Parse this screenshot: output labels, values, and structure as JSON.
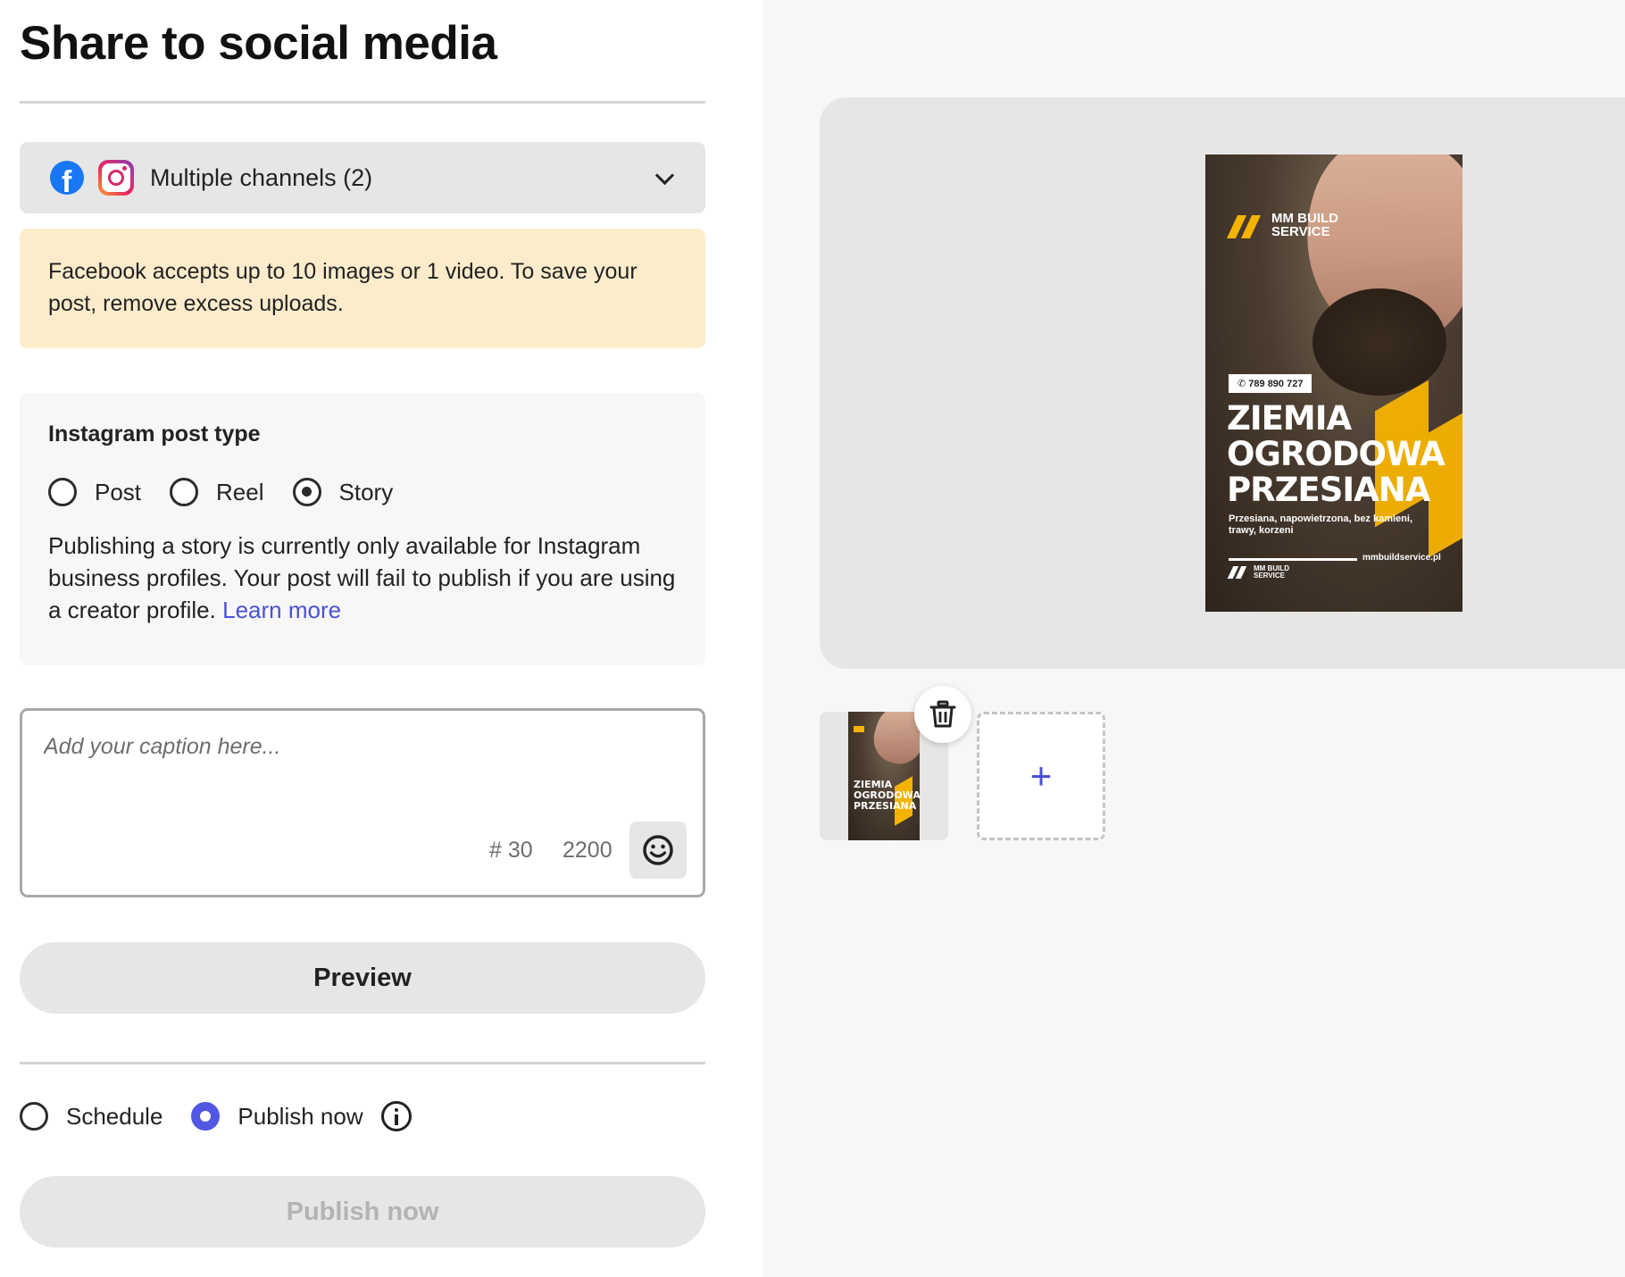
{
  "header": {
    "title": "Share to social media"
  },
  "channels": {
    "label": "Multiple channels (2)",
    "icons": [
      "facebook-icon",
      "instagram-icon"
    ]
  },
  "warning": {
    "text": "Facebook accepts up to 10 images or 1 video. To save your post, remove excess uploads."
  },
  "post_type": {
    "title": "Instagram post type",
    "options": [
      "Post",
      "Reel",
      "Story"
    ],
    "selected": "Story",
    "note": "Publishing a story is currently only available for Instagram business profiles. Your post will fail to publish if you are using a creator profile.",
    "learn_more": "Learn more"
  },
  "caption": {
    "placeholder": "Add your caption here...",
    "value": "",
    "hashtag_count": "# 30",
    "char_count": "2200"
  },
  "buttons": {
    "preview": "Preview",
    "publish": "Publish now"
  },
  "schedule": {
    "options": [
      "Schedule",
      "Publish now"
    ],
    "selected": "Publish now"
  },
  "poster": {
    "brand": "MM BUILD SERVICE",
    "brand_line1": "MM BUILD",
    "brand_line2": "SERVICE",
    "phone": "789 890 727",
    "headline_1": "ZIEMIA",
    "headline_2": "OGRODOWA",
    "headline_3": "PRZESIANA",
    "subtitle": "Przesiana, napowietrzona, bez kamieni, trawy, korzeni",
    "url": "mmbuildservice.pl",
    "thumb_headline": "ZIEMIA OGRODOWA PRZESIANA"
  },
  "colors": {
    "accent": "#5258e4",
    "link": "#4b4fd8",
    "warning_bg": "#fdeccb",
    "brand_yellow": "#f5b301"
  },
  "media": {
    "add_symbol": "+"
  }
}
